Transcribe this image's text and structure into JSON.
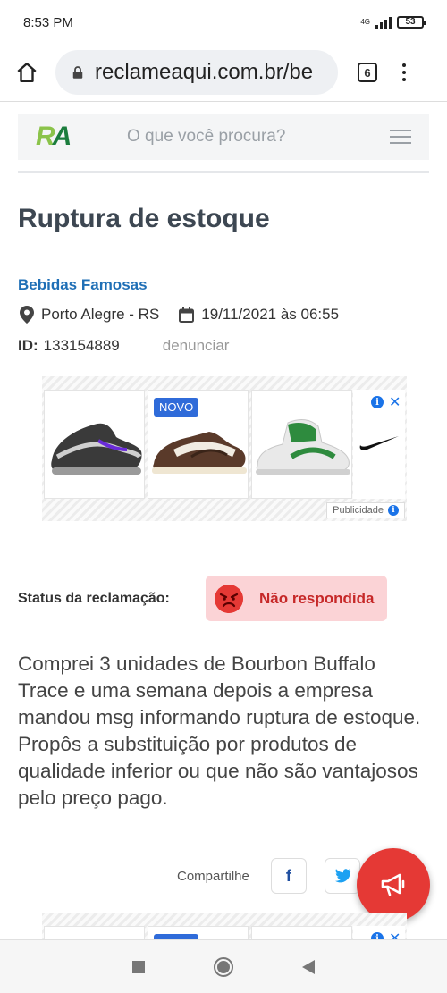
{
  "status_bar": {
    "time": "8:53 PM",
    "network": "4G",
    "battery": "53"
  },
  "browser": {
    "url": "reclameaqui.com.br/be",
    "tab_count": "6"
  },
  "site": {
    "logo": "RA",
    "search_placeholder": "O que você procura?"
  },
  "complaint": {
    "title": "Ruptura de estoque",
    "company": "Bebidas Famosas",
    "location": "Porto Alegre - RS",
    "datetime": "19/11/2021 às 06:55",
    "id_label": "ID:",
    "id_value": "133154889",
    "report_link": "denunciar",
    "status_label": "Status da reclamação:",
    "status_value": "Não respondida",
    "body": "Comprei 3 unidades de Bourbon Buffalo Trace e uma semana depois a empresa mandou msg informando ruptura de estoque. Propôs a substituição por produtos de qualidade inferior ou que não são vantajosos pelo preço pago."
  },
  "ad": {
    "badge": "NOVO",
    "label": "Publicidade",
    "brand_icon": "nike-swoosh-icon"
  },
  "share": {
    "label": "Compartilhe",
    "facebook": "f"
  },
  "colors": {
    "accent_blue": "#1f6fb6",
    "status_red": "#c62828",
    "status_bg": "#fbd3d6",
    "fab_red": "#e53935"
  }
}
